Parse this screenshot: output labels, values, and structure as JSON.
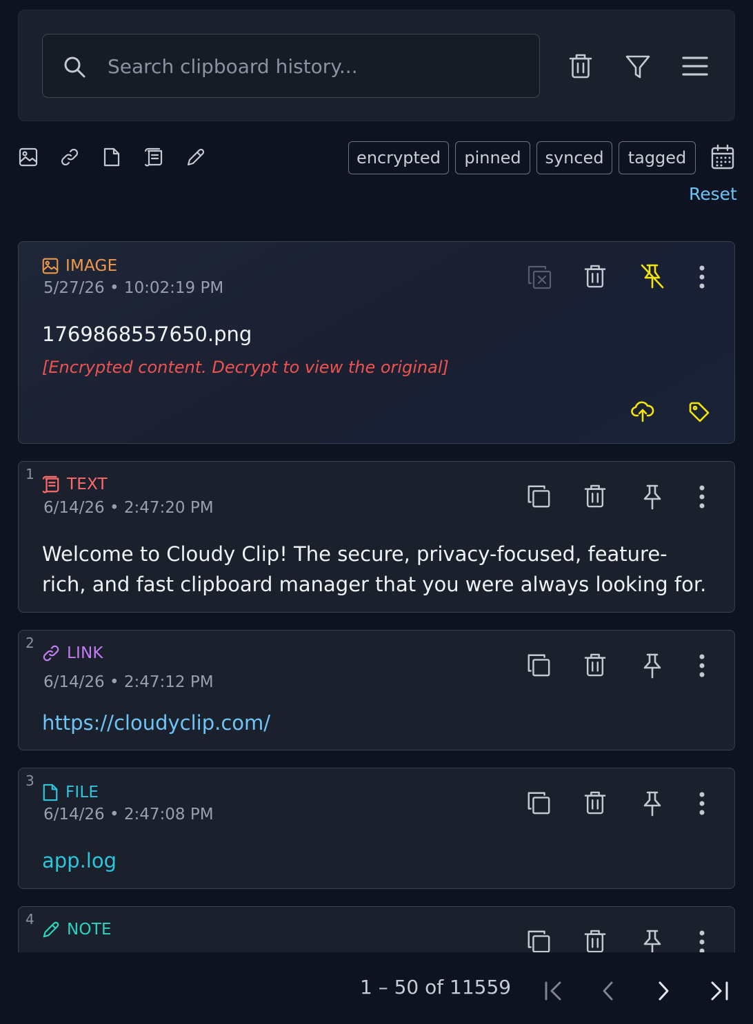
{
  "search": {
    "placeholder": "Search clipboard history..."
  },
  "header_actions": [
    "trash-icon",
    "filter-icon",
    "menu-icon"
  ],
  "type_filters": [
    "image-icon",
    "link-icon",
    "file-icon",
    "text-icon",
    "note-icon"
  ],
  "filter_chips": [
    "encrypted",
    "pinned",
    "synced",
    "tagged"
  ],
  "reset_label": "Reset",
  "cards": [
    {
      "index": "",
      "type": "IMAGE",
      "type_color": "#f0994a",
      "timestamp": "5/27/26 • 10:02:19 PM",
      "title": "1769868557650.png",
      "note": "[Encrypted content. Decrypt to view the original]",
      "note_color": "#ef5350",
      "pinned": true,
      "pin_color": "#f5e50e"
    },
    {
      "index": "1",
      "type": "TEXT",
      "type_color": "#ff6b6b",
      "timestamp": "6/14/26 • 2:47:20 PM",
      "content": "Welcome to Cloudy Clip! The secure, privacy-focused, feature-rich, and fast clipboard manager that you were always looking for."
    },
    {
      "index": "2",
      "type": "LINK",
      "type_color": "#c57cf5",
      "timestamp": "6/14/26 • 2:47:12 PM",
      "content": "https://cloudyclip.com/",
      "content_color": "#6ec4f7"
    },
    {
      "index": "3",
      "type": "FILE",
      "type_color": "#2bc6dd",
      "timestamp": "6/14/26 • 2:47:08 PM",
      "content": "app.log",
      "content_color": "#2bc6dd"
    },
    {
      "index": "4",
      "type": "NOTE",
      "type_color": "#2dd4bf"
    }
  ],
  "pagination": {
    "range_label": "1 – 50 of 11559"
  },
  "colors": {
    "background": "#0e1321",
    "panel": "#1a212c",
    "link": "#6ec4f7"
  }
}
